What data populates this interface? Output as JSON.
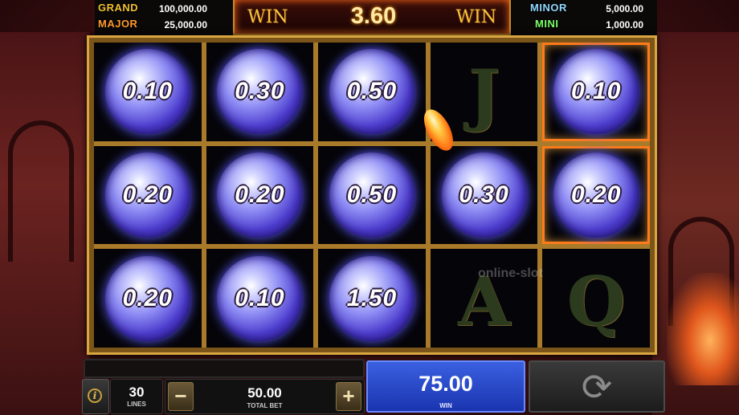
{
  "jackpots": {
    "grand": {
      "label": "GRAND",
      "value": "100,000.00"
    },
    "major": {
      "label": "MAJOR",
      "value": "25,000.00"
    },
    "minor": {
      "label": "MINOR",
      "value": "5,000.00"
    },
    "mini": {
      "label": "MINI",
      "value": "1,000.00"
    }
  },
  "win_display": {
    "left_word": "WIN",
    "amount": "3.60",
    "right_word": "WIN"
  },
  "reels": [
    [
      {
        "type": "orb",
        "value": "0.10"
      },
      {
        "type": "orb",
        "value": "0.30"
      },
      {
        "type": "orb",
        "value": "0.50"
      },
      {
        "type": "symbol",
        "value": "J"
      },
      {
        "type": "orb",
        "value": "0.10",
        "highlight": true
      }
    ],
    [
      {
        "type": "orb",
        "value": "0.20"
      },
      {
        "type": "orb",
        "value": "0.20"
      },
      {
        "type": "orb",
        "value": "0.50"
      },
      {
        "type": "orb",
        "value": "0.30"
      },
      {
        "type": "orb",
        "value": "0.20",
        "highlight": true
      }
    ],
    [
      {
        "type": "orb",
        "value": "0.20"
      },
      {
        "type": "orb",
        "value": "0.10"
      },
      {
        "type": "orb",
        "value": "1.50"
      },
      {
        "type": "symbol",
        "value": "A"
      },
      {
        "type": "symbol",
        "value": "Q"
      }
    ]
  ],
  "watermark": "online-slot",
  "controls": {
    "info_icon": "i",
    "lines": {
      "value": "30",
      "label": "LINES"
    },
    "total_bet": {
      "value": "50.00",
      "label": "TOTAL BET",
      "minus": "−",
      "plus": "+"
    },
    "win": {
      "value": "75.00",
      "label": "WIN"
    },
    "spin_icon": "⟳"
  },
  "colors": {
    "orb": "#6a5cf0",
    "win_box": "#2a48d0",
    "frame_gold": "#d9a640"
  }
}
